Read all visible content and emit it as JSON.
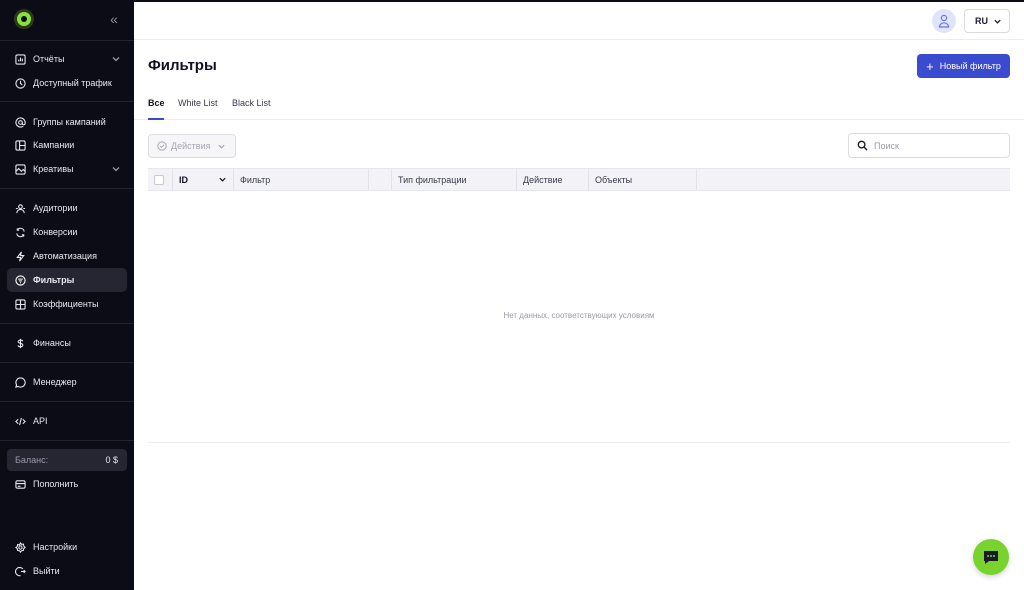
{
  "sidebar": {
    "items": [
      {
        "label": "Отчёты",
        "icon": "chart-icon"
      },
      {
        "label": "Доступный трафик",
        "icon": "clock-icon"
      },
      {
        "label": "Группы кампаний",
        "icon": "at-icon"
      },
      {
        "label": "Кампании",
        "icon": "layout-icon"
      },
      {
        "label": "Креативы",
        "icon": "image-icon"
      },
      {
        "label": "Аудитории",
        "icon": "audience-icon"
      },
      {
        "label": "Конверсии",
        "icon": "refresh-icon"
      },
      {
        "label": "Автоматизация",
        "icon": "bolt-icon"
      },
      {
        "label": "Фильтры",
        "icon": "filter-icon"
      },
      {
        "label": "Коэффициенты",
        "icon": "grid-icon"
      },
      {
        "label": "Финансы",
        "icon": "dollar-icon"
      },
      {
        "label": "Менеджер",
        "icon": "chat-icon"
      },
      {
        "label": "API",
        "icon": "code-icon"
      },
      {
        "label": "Пополнить",
        "icon": "wallet-icon"
      },
      {
        "label": "Настройки",
        "icon": "settings-icon"
      },
      {
        "label": "Выйти",
        "icon": "logout-icon"
      }
    ],
    "balance": {
      "label": "Баланс:",
      "value": "0 $"
    }
  },
  "header": {
    "language": "RU"
  },
  "page": {
    "title": "Фильтры",
    "new_button": "Новый фильтр",
    "tabs": [
      "Все",
      "White List",
      "Black List"
    ],
    "actions_label": "Действия",
    "search_placeholder": "Поиск"
  },
  "table": {
    "columns": [
      "ID",
      "Фильтр",
      "Тип фильтрации",
      "Действие",
      "Объекты"
    ],
    "empty_text": "Нет данных, соответствующих условиям"
  },
  "colors": {
    "accent": "#3b4bd0",
    "brand": "#79d32f",
    "sidebar": "#0c0c17"
  }
}
